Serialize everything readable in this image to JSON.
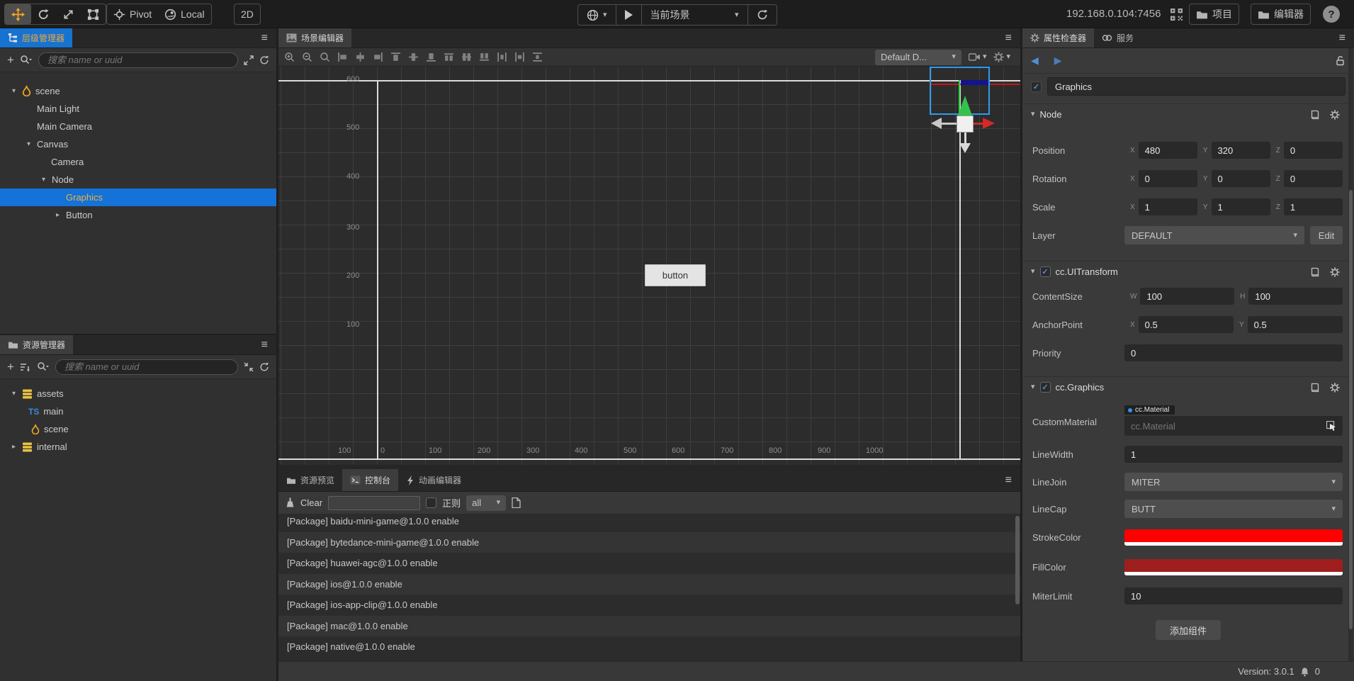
{
  "topbar": {
    "pivot": "Pivot",
    "local": "Local",
    "mode2d": "2D",
    "scene_select": "当前场景",
    "ip": "192.168.0.104:7456",
    "project": "项目",
    "editor": "编辑器",
    "help": "?"
  },
  "hierarchy": {
    "title": "层级管理器",
    "search_placeholder": "搜索 name or uuid",
    "tree": [
      {
        "label": "scene"
      },
      {
        "label": "Main Light"
      },
      {
        "label": "Main Camera"
      },
      {
        "label": "Canvas"
      },
      {
        "label": "Camera"
      },
      {
        "label": "Node"
      },
      {
        "label": "Graphics"
      },
      {
        "label": "Button"
      }
    ]
  },
  "assets": {
    "title": "资源管理器",
    "search_placeholder": "搜索 name or uuid",
    "ts_badge": "TS",
    "tree": [
      {
        "label": "assets"
      },
      {
        "label": "main"
      },
      {
        "label": "scene"
      },
      {
        "label": "internal"
      }
    ]
  },
  "scene": {
    "title": "场景编辑器",
    "display_dropdown": "Default D...",
    "button_label": "button",
    "ruler_x": [
      "100",
      "0",
      "100",
      "200",
      "300",
      "400",
      "500",
      "600",
      "700",
      "800",
      "900",
      "1000"
    ],
    "ruler_y": [
      "600",
      "500",
      "400",
      "300",
      "200",
      "100"
    ]
  },
  "console": {
    "tabs": [
      "资源预览",
      "控制台",
      "动画编辑器"
    ],
    "clear": "Clear",
    "regex_label": "正则",
    "filter_value": "all",
    "logs": [
      "[Package] baidu-mini-game@1.0.0 enable",
      "[Package] bytedance-mini-game@1.0.0 enable",
      "[Package] huawei-agc@1.0.0 enable",
      "[Package] ios@1.0.0 enable",
      "[Package] ios-app-clip@1.0.0 enable",
      "[Package] mac@1.0.0 enable",
      "[Package] native@1.0.0 enable"
    ]
  },
  "inspector": {
    "tab_inspector": "属性检查器",
    "tab_service": "服务",
    "node_name": "Graphics",
    "axes": {
      "x": "X",
      "y": "Y",
      "z": "Z",
      "w": "W",
      "h": "H"
    },
    "node": {
      "title": "Node",
      "position": {
        "label": "Position",
        "x": "480",
        "y": "320",
        "z": "0"
      },
      "rotation": {
        "label": "Rotation",
        "x": "0",
        "y": "0",
        "z": "0"
      },
      "scale": {
        "label": "Scale",
        "x": "1",
        "y": "1",
        "z": "1"
      },
      "layer": {
        "label": "Layer",
        "value": "DEFAULT",
        "edit": "Edit"
      }
    },
    "uitransform": {
      "title": "cc.UITransform",
      "content_size": {
        "label": "ContentSize",
        "w": "100",
        "h": "100"
      },
      "anchor_point": {
        "label": "AnchorPoint",
        "x": "0.5",
        "y": "0.5"
      },
      "priority": {
        "label": "Priority",
        "value": "0"
      }
    },
    "graphics": {
      "title": "cc.Graphics",
      "custom_material": {
        "label": "CustomMaterial",
        "tag": "cc.Material",
        "placeholder": "cc.Material"
      },
      "line_width": {
        "label": "LineWidth",
        "value": "1"
      },
      "line_join": {
        "label": "LineJoin",
        "value": "MITER"
      },
      "line_cap": {
        "label": "LineCap",
        "value": "BUTT"
      },
      "stroke_color": {
        "label": "StrokeColor",
        "value": "#ff0000"
      },
      "fill_color": {
        "label": "FillColor",
        "value": "#9e1e1e"
      },
      "miter_limit": {
        "label": "MiterLimit",
        "value": "10"
      }
    },
    "add_component": "添加组件"
  },
  "statusbar": {
    "version": "Version: 3.0.1",
    "notifications": "0"
  },
  "colors": {
    "accent_blue": "#1673d1",
    "selection_text": "#f0a83c",
    "stroke_swatch": "#ff0000",
    "fill_swatch": "#9e1e1e",
    "gizmo_green": "#35c24a",
    "gizmo_red": "#d62828",
    "gizmo_blue": "#2e9bf0"
  }
}
